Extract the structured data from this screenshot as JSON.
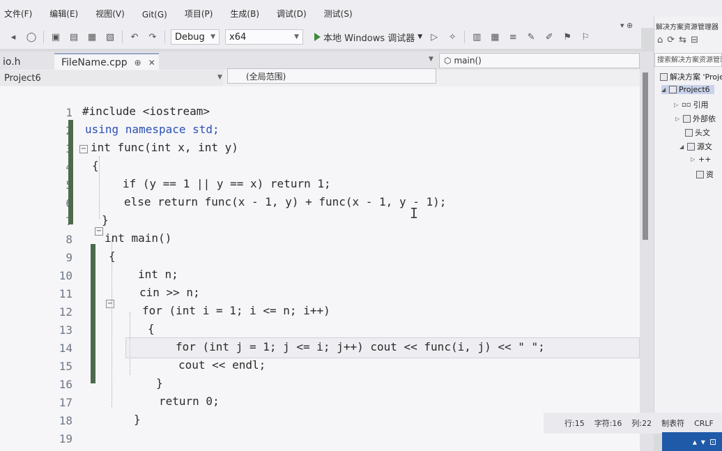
{
  "menu": [
    "文件(F)",
    "编辑(E)",
    "视图(V)",
    "Git(G)",
    "项目(P)",
    "生成(B)",
    "调试(D)",
    "测试(S)"
  ],
  "toolbar": {
    "config": "Debug",
    "platform": "x64",
    "debugger_label": "本地 Windows 调试器"
  },
  "tabs": [
    {
      "label": "io.h"
    },
    {
      "label": "FileName.cpp"
    }
  ],
  "navigation": {
    "project": "Project6",
    "scope": "(全局范围)",
    "member": "main()"
  },
  "editor": {
    "line_numbers": [
      "1",
      "2",
      "3",
      "4",
      "5",
      "6",
      "7",
      "8",
      "9",
      "10",
      "11",
      "12",
      "13",
      "14",
      "15",
      "16",
      "17",
      "18",
      "19"
    ],
    "lines": [
      "#include <iostream>",
      "using namespace std;",
      "int func(int x, int y)",
      "{",
      "if (y == 1 || y == x) return 1;",
      "else return func(x - 1, y) + func(x - 1, y - 1);",
      "}",
      "int main()",
      "{",
      "int n;",
      "cin >> n;",
      "for (int i = 1; i <= n; i++)",
      "{",
      "for (int j = 1; j <= i; j++) cout << func(i, j) << \" \";",
      "cout << endl;",
      "}",
      "return 0;",
      "}",
      ""
    ]
  },
  "solution_explorer": {
    "title": "解决方案资源管理器",
    "search_placeholder": "搜索解决方案资源管理",
    "items": [
      {
        "label": "解决方案 'Proje"
      },
      {
        "label": "Project6"
      },
      {
        "label": "引用"
      },
      {
        "label": "外部依"
      },
      {
        "label": "头文"
      },
      {
        "label": "源文"
      },
      {
        "label": "++"
      },
      {
        "label": "资"
      }
    ]
  },
  "status": {
    "line": "行:15",
    "char": "字符:16",
    "col": "列:22",
    "tabs": "制表符",
    "eol": "CRLF"
  }
}
